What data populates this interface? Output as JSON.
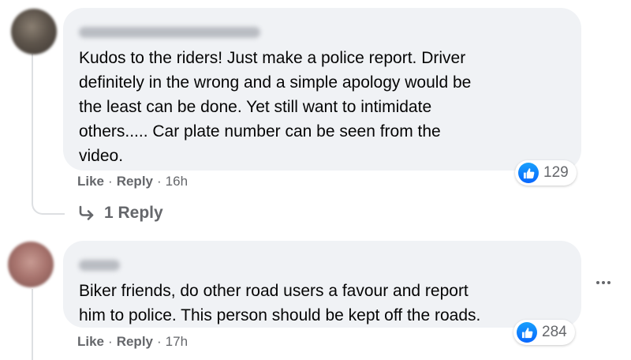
{
  "comments": [
    {
      "text": "Kudos to the riders! Just make a police report. Driver\ndefinitely in the wrong and a simple apology would be\nthe least can be done. Yet still want to intimidate\nothers..... Car plate number can be seen from the\nvideo.",
      "like_label": "Like",
      "reply_label": "Reply",
      "time": "16h",
      "reaction_count": "129",
      "replies_label": "1 Reply"
    },
    {
      "text": "Biker friends, do other road users a favour and report\nhim to police. This person should be kept off the roads.",
      "like_label": "Like",
      "reply_label": "Reply",
      "time": "17h",
      "reaction_count": "284"
    }
  ],
  "separator": "·",
  "icons": {
    "reaction": "like-icon",
    "reply_arrow": "reply-arrow-icon",
    "more": "more-options-icon"
  },
  "colors": {
    "bubble": "#f0f2f5",
    "secondary_text": "#65676b",
    "like_blue": "#0866ff"
  }
}
